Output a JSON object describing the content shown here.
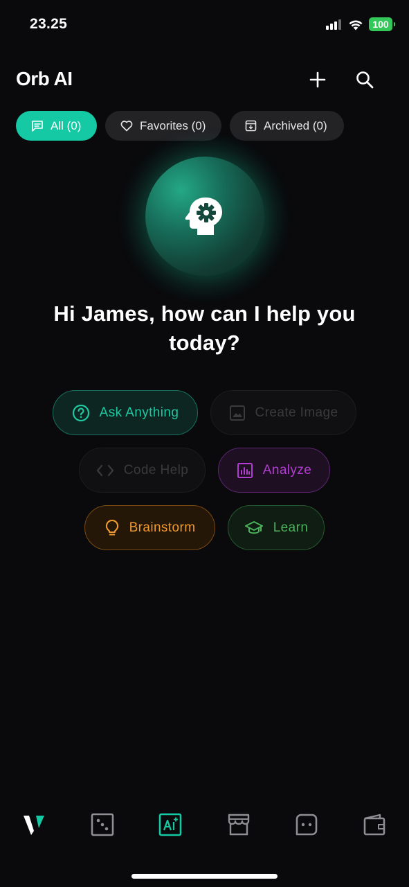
{
  "status_bar": {
    "time": "23.25",
    "battery": "100"
  },
  "header": {
    "title": "Orb AI",
    "icons": [
      "plus-icon",
      "search-icon"
    ]
  },
  "filters": [
    {
      "label": "All (0)",
      "icon": "chat-icon",
      "active": true
    },
    {
      "label": "Favorites (0)",
      "icon": "heart-icon",
      "active": false
    },
    {
      "label": "Archived (0)",
      "icon": "archive-icon",
      "active": false
    }
  ],
  "hero": {
    "icon": "head-gear-icon",
    "greeting": "Hi James, how can I help you today?"
  },
  "suggestions": [
    {
      "label": "Ask Anything",
      "icon": "question-circle-icon",
      "color": "#1fc8a0"
    },
    {
      "label": "Create Image",
      "icon": "image-icon",
      "color": "#3a3a3d"
    },
    {
      "label": "Code Help",
      "icon": "code-icon",
      "color": "#3a3a3d"
    },
    {
      "label": "Analyze",
      "icon": "bar-chart-icon",
      "color": "#b33cd3"
    },
    {
      "label": "Brainstorm",
      "icon": "lightbulb-icon",
      "color": "#f09a2c"
    },
    {
      "label": "Learn",
      "icon": "graduation-cap-icon",
      "color": "#4cb25c"
    }
  ],
  "bottom_nav": [
    {
      "icon": "brand-logo-icon",
      "active": false
    },
    {
      "icon": "dice-icon",
      "active": false
    },
    {
      "icon": "ai-icon",
      "active": true
    },
    {
      "icon": "store-icon",
      "active": false
    },
    {
      "icon": "chat-bubble-icon",
      "active": false
    },
    {
      "icon": "wallet-icon",
      "active": false
    }
  ],
  "colors": {
    "accent": "#14c9a3",
    "background": "#0a0a0c",
    "chip_inactive": "#232326"
  }
}
